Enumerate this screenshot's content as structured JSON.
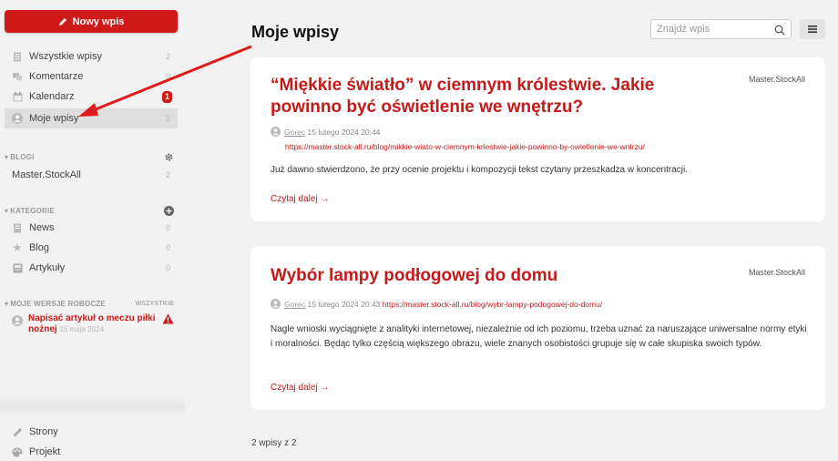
{
  "sidebar": {
    "new_post": "Nowy wpis",
    "items": [
      {
        "label": "Wszystkie wpisy",
        "count": "2"
      },
      {
        "label": "Komentarze",
        "count": "0"
      },
      {
        "label": "Kalendarz",
        "badge": "1"
      },
      {
        "label": "Moje wpisy",
        "count": "2"
      }
    ],
    "blogs_head": "Blogi",
    "blogs": [
      {
        "label": "Master.StockAll",
        "count": "2"
      }
    ],
    "categories_head": "Kategorie",
    "categories": [
      {
        "label": "News",
        "count": "0"
      },
      {
        "label": "Blog",
        "count": "0"
      },
      {
        "label": "Artykuły",
        "count": "0"
      }
    ],
    "drafts_head": "Moje wersje robocze",
    "drafts_all": "Wszystkie",
    "draft": {
      "title": "Napisać artykuł o meczu piłki nożnej",
      "date": "15 maja 2024"
    },
    "footer": [
      {
        "label": "Strony"
      },
      {
        "label": "Projekt"
      }
    ]
  },
  "main": {
    "title": "Moje wpisy",
    "search_placeholder": "Znajdź wpis",
    "posts": [
      {
        "title": "“Miękkie światło” w ciemnym królestwie. Jakie powinno być oświetlenie we wnętrzu?",
        "blog": "Master.StockAll",
        "author": "Gorec",
        "date": "15 lutego 2024 20:44",
        "url": "https://master.stock-all.ru/blog/mikkie-wiato-w-ciemnym-krlestwie-jakie-powinno-by-owietlenie-we-wntrzu/",
        "excerpt": "Już dawno stwierdzono, że przy ocenie projektu i kompozycji tekst czytany przeszkadza w koncentracji.",
        "read_more": "Czytaj dalej →"
      },
      {
        "title": "Wybór lampy podłogowej do domu",
        "blog": "Master.StockAll",
        "author": "Gorec",
        "date": "15 lutego 2024 20:43",
        "url": "https://master.stock-all.ru/blog/wybr-lampy-podogowej-do-domu/",
        "excerpt": "Nagle wnioski wyciągnięte z analityki internetowej, niezależnie od ich poziomu, trzeba uznać za naruszające uniwersalne normy etyki i moralności. Będąc tylko częścią większego obrazu, wiele znanych osobistości grupuje się w całe skupiska swoich typów.",
        "read_more": "Czytaj dalej →"
      }
    ],
    "pager": "2 wpisy z 2"
  },
  "colors": {
    "accent": "#d01919",
    "link": "#c51a1a",
    "bg": "#f2f2f2"
  }
}
